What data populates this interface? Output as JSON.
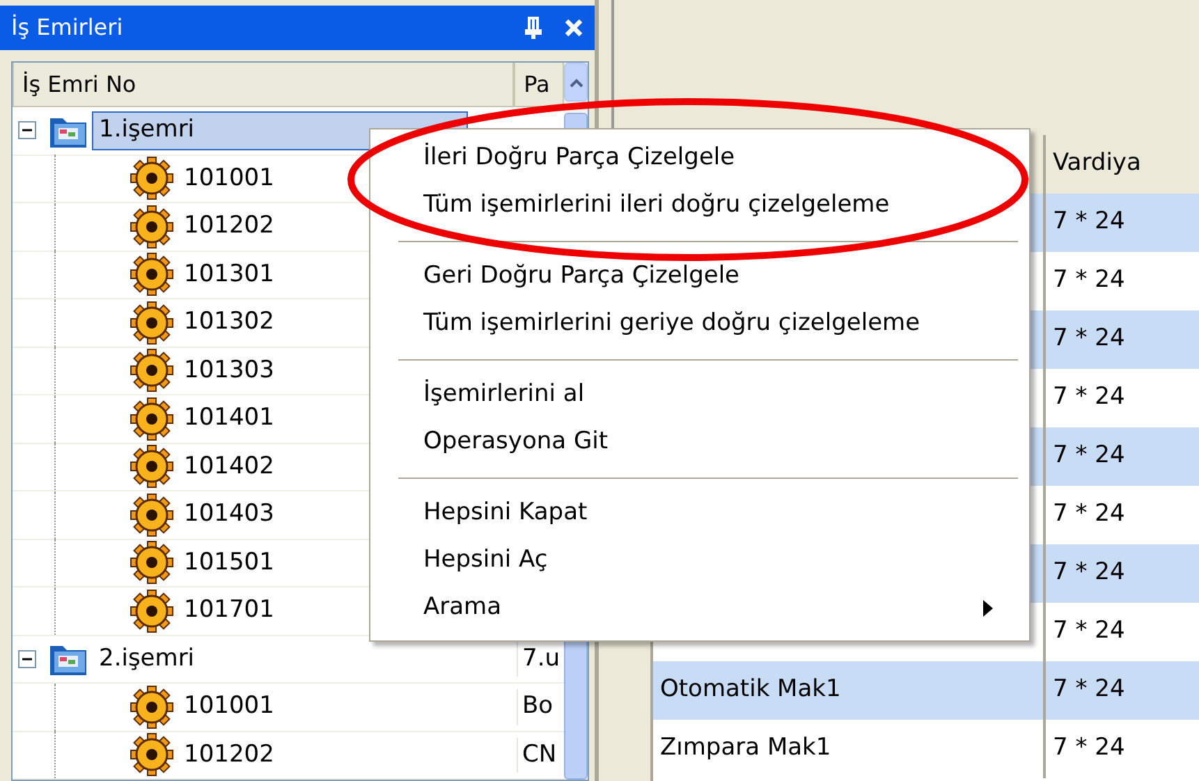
{
  "panel": {
    "title": "İş Emirleri",
    "columns": [
      "İş Emri No",
      "Pa"
    ],
    "tree": [
      {
        "label": "1.işemri",
        "selected": true,
        "expanded": true,
        "children": [
          {
            "label": "101001"
          },
          {
            "label": "101202"
          },
          {
            "label": "101301"
          },
          {
            "label": "101302"
          },
          {
            "label": "101303"
          },
          {
            "label": "101401"
          },
          {
            "label": "101402"
          },
          {
            "label": "101403"
          },
          {
            "label": "101501"
          },
          {
            "label": "101701"
          }
        ]
      },
      {
        "label": "2.işemri",
        "column_2": "7.u",
        "selected": false,
        "expanded": true,
        "children": [
          {
            "label": "101001",
            "column_2": "Bo"
          },
          {
            "label": "101202",
            "column_2": "CN"
          }
        ]
      }
    ]
  },
  "grid": {
    "columns": [
      "",
      "Vardiya"
    ],
    "rows": [
      {
        "name": "",
        "shift": "7 * 24"
      },
      {
        "name": "",
        "shift": "7 * 24"
      },
      {
        "name": "",
        "shift": "7 * 24"
      },
      {
        "name": "",
        "shift": "7 * 24"
      },
      {
        "name": "",
        "shift": "7 * 24"
      },
      {
        "name": "",
        "shift": "7 * 24"
      },
      {
        "name": "",
        "shift": "7 * 24"
      },
      {
        "name": "",
        "shift": "7 * 24"
      },
      {
        "name": "Otomatik Mak1",
        "shift": "7 * 24"
      },
      {
        "name": "Zımpara Mak1",
        "shift": "7 * 24"
      }
    ]
  },
  "context_menu": {
    "groups": [
      [
        {
          "label": "İleri Doğru Parça Çizelgele",
          "submenu": false
        },
        {
          "label": "Tüm işemirlerini ileri doğru çizelgeleme",
          "submenu": false
        }
      ],
      [
        {
          "label": "Geri Doğru Parça Çizelgele",
          "submenu": false
        },
        {
          "label": "Tüm işemirlerini geriye doğru çizelgeleme",
          "submenu": false
        }
      ],
      [
        {
          "label": "İşemirlerini al",
          "submenu": false
        },
        {
          "label": "Operasyona Git",
          "submenu": false
        }
      ],
      [
        {
          "label": "Hepsini Kapat",
          "submenu": false
        },
        {
          "label": "Hepsini Aç",
          "submenu": false
        },
        {
          "label": "Arama",
          "submenu": true
        }
      ]
    ]
  }
}
